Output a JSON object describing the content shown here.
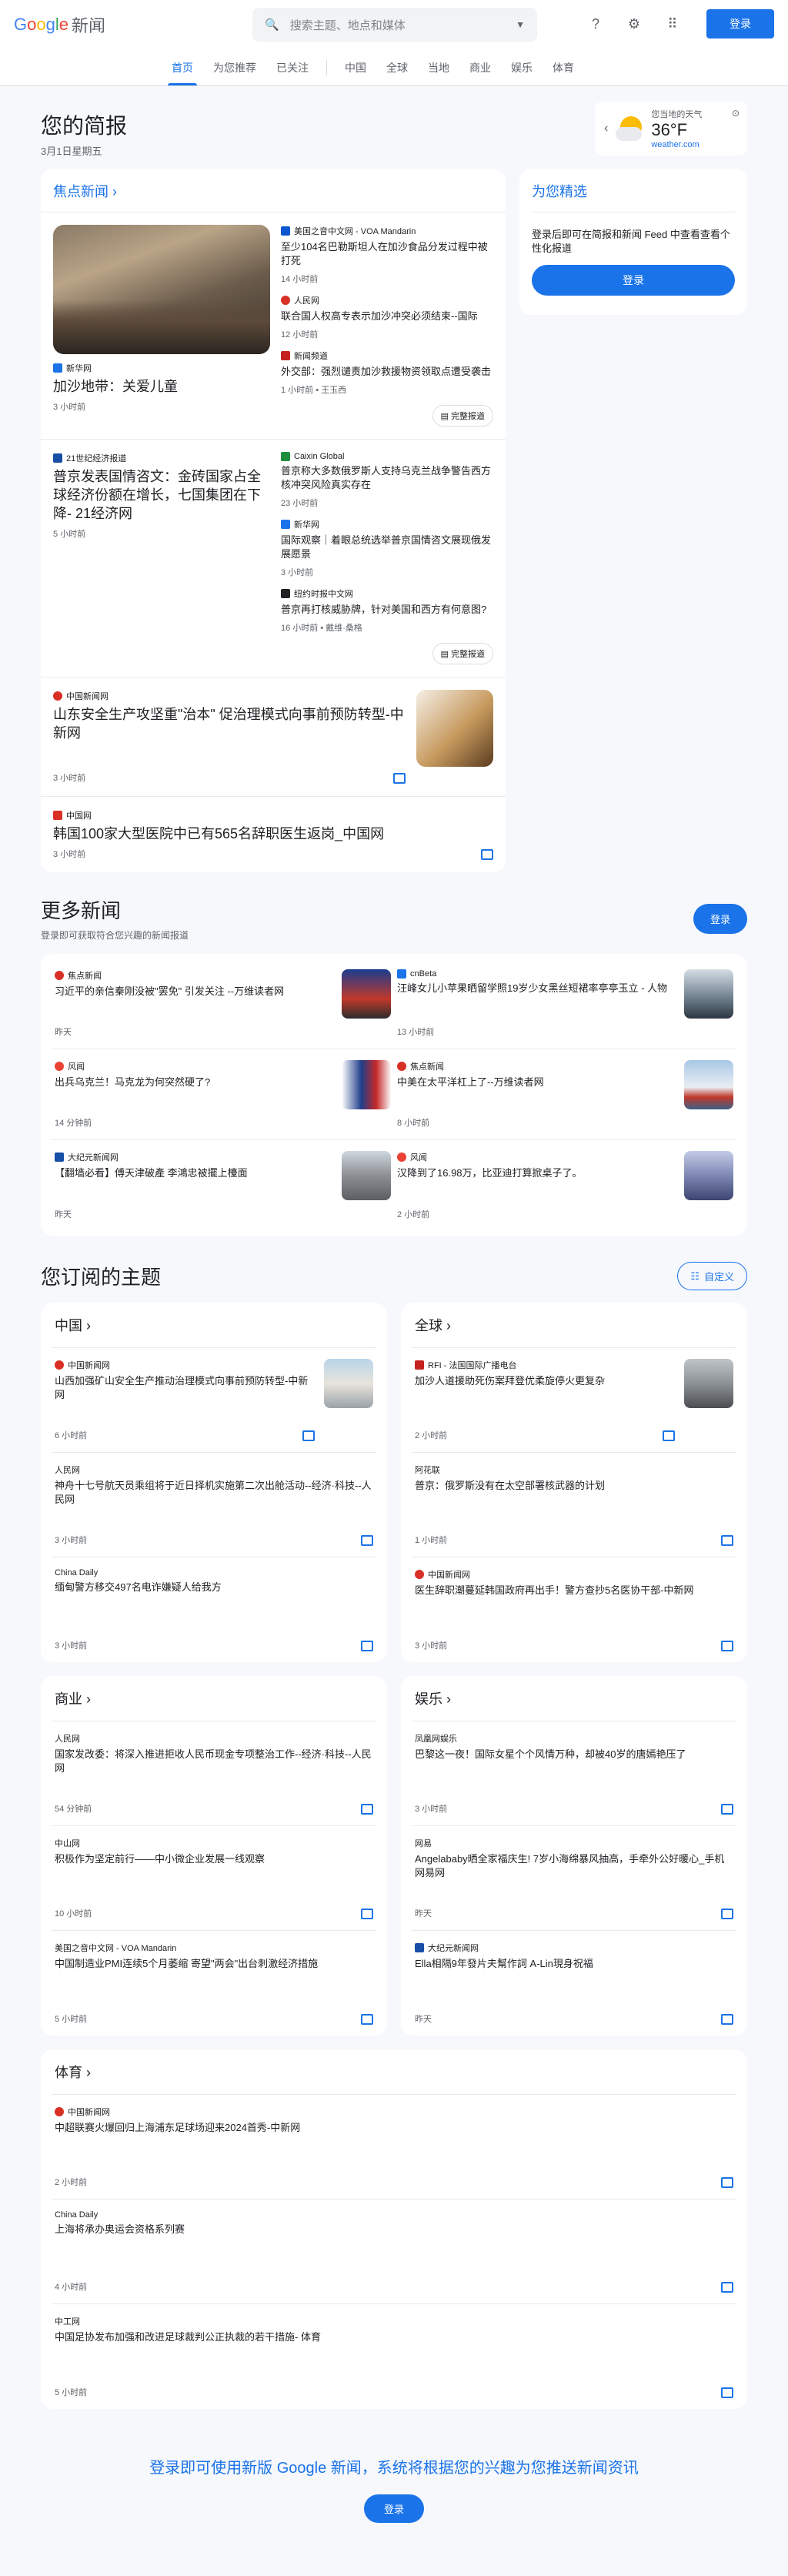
{
  "header": {
    "logo": {
      "g1": "G",
      "g2": "o",
      "g3": "o",
      "g4": "g",
      "g5": "l",
      "g6": "e",
      "news": "新闻"
    },
    "search_placeholder": "搜索主题、地点和媒体",
    "login": "登录"
  },
  "nav": [
    "首页",
    "为您推荐",
    "已关注",
    "中国",
    "全球",
    "当地",
    "商业",
    "娱乐",
    "体育"
  ],
  "brief": {
    "title": "您的简报",
    "date": "3月1日星期五"
  },
  "weather": {
    "label": "您当地的天气",
    "temp": "36°F",
    "source": "weather.com"
  },
  "top_stories": {
    "title": "焦点新闻 ›",
    "cluster1": {
      "lead": {
        "source": "新华网",
        "headline": "加沙地带：关爱儿童",
        "time": "3 小时前"
      },
      "subs": [
        {
          "source": "美国之音中文网 - VOA Mandarin",
          "headline": "至少104名巴勒斯坦人在加沙食品分发过程中被打死",
          "time": "14 小时前"
        },
        {
          "source": "人民网",
          "headline": "联合国人权高专表示加沙冲突必须结束--国际",
          "time": "12 小时前"
        },
        {
          "source": "新闻频道",
          "headline": "外交部：强烈谴责加沙救援物资领取点遭受袭击",
          "time": "1 小时前 • 王玉西"
        }
      ],
      "full": "完整报道"
    },
    "cluster2": {
      "lead": {
        "source": "21世纪经济报道",
        "headline": "普京发表国情咨文：金砖国家占全球经济份额在增长，七国集团在下降- 21经济网",
        "time": "5 小时前"
      },
      "subs": [
        {
          "source": "Caixin Global",
          "headline": "普京称大多数俄罗斯人支持乌克兰战争警告西方核冲突风险真实存在",
          "time": "23 小时前"
        },
        {
          "source": "新华网",
          "headline": "国际观察｜着眼总统选举普京国情咨文展现俄发展愿景",
          "time": "3 小时前"
        },
        {
          "source": "纽约时报中文网",
          "headline": "普京再打核威胁牌，针对美国和西方有何意图?",
          "time": "16 小时前 • 戴维·桑格"
        }
      ],
      "full": "完整报道"
    },
    "single1": {
      "source": "中国新闻网",
      "headline": "山东安全生产攻坚重\"治本\" 促治理模式向事前预防转型-中新网",
      "time": "3 小时前"
    },
    "single2": {
      "source": "中国网",
      "headline": "韩国100家大型医院中已有565名辞职医生返岗_中国网",
      "time": "3 小时前"
    }
  },
  "for_you": {
    "title": "为您精选",
    "text": "登录后即可在简报和新闻 Feed 中查看查看个性化报道",
    "button": "登录"
  },
  "more_news": {
    "title": "更多新闻",
    "subtitle": "登录即可获取符合您兴趣的新闻报道",
    "button": "登录",
    "items": [
      {
        "source": "焦点新闻",
        "headline": "习近平的亲信秦刚没被\"罢免\" 引发关注 --万维读者网",
        "time": "昨天"
      },
      {
        "source": "cnBeta",
        "headline": "汪峰女儿小苹果晒留学照19岁少女黑丝短裙率亭亭玉立 - 人物",
        "time": "13 小时前"
      },
      {
        "source": "风闻",
        "headline": "出兵乌克兰！马克龙为何突然硬了?",
        "time": "14 分钟前"
      },
      {
        "source": "焦点新闻",
        "headline": "中美在太平洋杠上了--万维读者网",
        "time": "8 小时前"
      },
      {
        "source": "大纪元新闻网",
        "headline": "【翻墙必看】傅天津破產 李鴻忠被擺上檯面",
        "time": "昨天"
      },
      {
        "source": "风闻",
        "headline": "汉降到了16.98万，比亚迪打算掀桌子了。",
        "time": "2 小时前"
      }
    ]
  },
  "topics": {
    "title": "您订阅的主题",
    "customize": "自定义",
    "cards": [
      {
        "name": "中国 ›",
        "items": [
          {
            "source": "中国新闻网",
            "headline": "山西加强矿山安全生产推动治理模式向事前预防转型-中新网",
            "time": "6 小时前"
          },
          {
            "source": "人民网",
            "headline": "神舟十七号航天员乘组将于近日择机实施第二次出舱活动--经济·科技--人民网",
            "time": "3 小时前"
          },
          {
            "source": "China Daily",
            "headline": "缅甸警方移交497名电诈嫌疑人给我方",
            "time": "3 小时前"
          }
        ]
      },
      {
        "name": "全球 ›",
        "items": [
          {
            "source": "RFI - 法国国际广播电台",
            "headline": "加沙人道援助死伤案拜登优柔旋停火更复杂",
            "time": "2 小时前"
          },
          {
            "source": "阿花联",
            "headline": "普京：俄罗斯没有在太空部署核武器的计划",
            "time": "1 小时前"
          },
          {
            "source": "中国新闻网",
            "headline": "医生辞职潮蔓延韩国政府再出手！警方查抄5名医协干部-中新网",
            "time": "3 小时前"
          }
        ]
      },
      {
        "name": "商业 ›",
        "items": [
          {
            "source": "人民网",
            "headline": "国家发改委：将深入推进拒收人民币现金专项整治工作--经济·科技--人民网",
            "time": "54 分钟前"
          },
          {
            "source": "中山网",
            "headline": "积极作为坚定前行——中小微企业发展一线观察",
            "time": "10 小时前"
          },
          {
            "source": "美国之音中文网 - VOA Mandarin",
            "headline": "中国制造业PMI连续5个月萎缩 寄望\"两会\"出台刺激经济措施",
            "time": "5 小时前"
          }
        ]
      },
      {
        "name": "娱乐 ›",
        "items": [
          {
            "source": "凤凰网娱乐",
            "headline": "巴黎这一夜！国际女星个个风情万种，却被40岁的唐嫣艳压了",
            "time": "3 小时前"
          },
          {
            "source": "网易",
            "headline": "Angelababy晒全家福庆生! 7岁小海绵暴风抽高，手牵外公好暖心_手机网易网",
            "time": "昨天"
          },
          {
            "source": "大纪元新闻网",
            "headline": "Ella相隔9年發片夫幫作詞 A-Lin現身祝福",
            "time": "昨天"
          }
        ]
      },
      {
        "name": "体育 ›",
        "items": [
          {
            "source": "中国新闻网",
            "headline": "中超联赛火爆回归上海浦东足球场迎来2024首秀-中新网",
            "time": "2 小时前"
          },
          {
            "source": "China Daily",
            "headline": "上海将承办奥运会资格系列赛",
            "time": "4 小时前"
          },
          {
            "source": "中工网",
            "headline": "中国足协发布加强和改进足球裁判公正执裁的若干措施- 体育",
            "time": "5 小时前"
          }
        ]
      }
    ]
  },
  "footer": {
    "message": "登录即可使用新版 Google 新闻，系统将根据您的兴趣为您推送新闻资讯",
    "button": "登录"
  },
  "colors": {
    "accent": "#1a73e8"
  }
}
